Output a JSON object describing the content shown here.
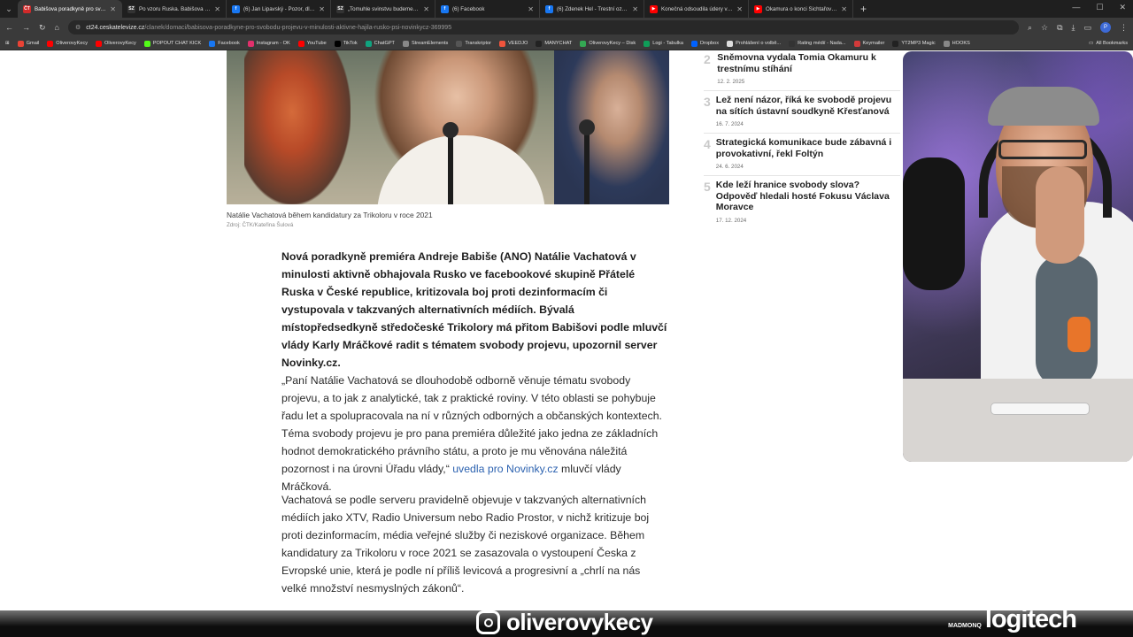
{
  "browser": {
    "tabs": [
      {
        "title": "Babišova poradkyně pro svobo",
        "favicon": "ČT",
        "color": "#d02a2a",
        "active": true
      },
      {
        "title": "Po vzoru Ruska. Babišova pora",
        "favicon": "SZ",
        "color": "#333333",
        "active": false
      },
      {
        "title": "(6) Jan Lipavský - Pozor, dlouh",
        "favicon": "f",
        "color": "#1877f2",
        "active": false
      },
      {
        "title": "„Tomuhle svinstvu budeme brá",
        "favicon": "SZ",
        "color": "#333333",
        "active": false
      },
      {
        "title": "(6) Facebook",
        "favicon": "f",
        "color": "#1877f2",
        "active": false
      },
      {
        "title": "(6) Zdenek Hel - Trestní oznám",
        "favicon": "f",
        "color": "#1877f2",
        "active": false
      },
      {
        "title": "Konečná odsoudila údery v Írá",
        "favicon": "▶",
        "color": "#ff0000",
        "active": false
      },
      {
        "title": "Okamura o konci Šichtařové: O",
        "favicon": "▶",
        "color": "#ff0000",
        "active": false
      }
    ],
    "url_domain": "ct24.ceskatelevize.cz",
    "url_path": "/clanek/domaci/babisova-poradkyne-pro-svobodu-projevu-v-minulosti-aktivne-hajila-rusko-psi-novinkycz-369995",
    "profile_initial": "P",
    "bookmarks": [
      {
        "label": "Gmail",
        "color": "#ea4335"
      },
      {
        "label": "OliverovyKecy",
        "color": "#ff0000"
      },
      {
        "label": "OliverovyKecy",
        "color": "#ff0000"
      },
      {
        "label": "POPOUT CHAT KICK",
        "color": "#53fc18"
      },
      {
        "label": "Facebook",
        "color": "#1877f2"
      },
      {
        "label": "Instagram - OK",
        "color": "#e1306c"
      },
      {
        "label": "YouTube",
        "color": "#ff0000"
      },
      {
        "label": "TikTok",
        "color": "#000000"
      },
      {
        "label": "ChatGPT",
        "color": "#10a37f"
      },
      {
        "label": "StreamElements",
        "color": "#888888"
      },
      {
        "label": "Transkriptor",
        "color": "#555555"
      },
      {
        "label": "VEEDJO",
        "color": "#f0543c"
      },
      {
        "label": "MANYCHAT",
        "color": "#222222"
      },
      {
        "label": "OliverovyKecy – Disk",
        "color": "#34a853"
      },
      {
        "label": "Logi - Tabulka",
        "color": "#0f9d58"
      },
      {
        "label": "Dropbox",
        "color": "#0061ff"
      },
      {
        "label": "Prohlášení o volbě...",
        "color": "#dddddd"
      },
      {
        "label": "Rating médií - Nada...",
        "color": "#333333"
      },
      {
        "label": "Keymailer",
        "color": "#d23a3a"
      },
      {
        "label": "YT2MP3 Magic",
        "color": "#222222"
      },
      {
        "label": "HOOKS",
        "color": "#888888"
      }
    ],
    "all_bookmarks": "All Bookmarks"
  },
  "article": {
    "photo_caption": "Natálie Vachatová během kandidatury za Trikoloru v roce 2021",
    "photo_credit": "Zdroj: ČTK/Kateřina Šulová",
    "lead": "Nová poradkyně premiéra Andreje Babiše (ANO) Natálie Vachatová v minulosti aktivně obhajovala Rusko ve facebookové skupině Přátelé Ruska v České republice, kritizovala boj proti dezinformacím či vystupovala v takzvaných alternativních médiích. Bývalá místopředsedkyně středočeské Trikolory má přitom Babišovi podle mluvčí vlády Karly Mráčkové radit s tématem svobody projevu, upozornil server Novinky.cz.",
    "quote_text": "„Paní Natálie Vachatová se dlouhodobě odborně věnuje tématu svobody projevu, a to jak z analytické, tak z praktické roviny. V této oblasti se pohybuje řadu let a spolupracovala na ní v různých odborných a občanských kontextech. Téma svobody projevu je pro pana premiéra důležité jako jedna ze základních hodnot demokratického právního státu, a proto je mu věnována náležitá pozornost i na úrovni Úřadu vlády,“",
    "quote_link": "uvedla pro Novinky.cz",
    "quote_tail": "mluvčí vlády Mráčková.",
    "paragraph2": "Vachatová se podle serveru pravidelně objevuje v takzvaných alternativních médiích jako XTV, Radio Universum nebo Radio Prostor, v nichž kritizuje boj proti dezinformacím, média veřejné služby či neziskové organizace. Během kandidatury za Trikoloru v roce 2021 se zasazovala o vystoupení Česka z Evropské unie, která je podle ní příliš levicová a progresivní a „chrlí na nás velké množství nesmyslných zákonů“."
  },
  "most_read": [
    {
      "num": "2",
      "title": "Sněmovna vydala Tomia Okamuru k trestnímu stíhání",
      "date": "12. 2. 2025"
    },
    {
      "num": "3",
      "title": "Lež není názor, říká ke svobodě projevu na sítích ústavní soudkyně Křesťanová",
      "date": "16. 7. 2024"
    },
    {
      "num": "4",
      "title": "Strategická komunikace bude zábavná i provokativní, řekl Foltýn",
      "date": "24. 6. 2024"
    },
    {
      "num": "5",
      "title": "Kde leží hranice svobody slova? Odpověď hledali hosté Fokusu Václava Moravce",
      "date": "17. 12. 2024"
    }
  ],
  "overlay": {
    "instagram_handle": "oliverovykecy",
    "sponsor_prefix": "MADMONQ",
    "sponsor_brand": "logitech"
  }
}
